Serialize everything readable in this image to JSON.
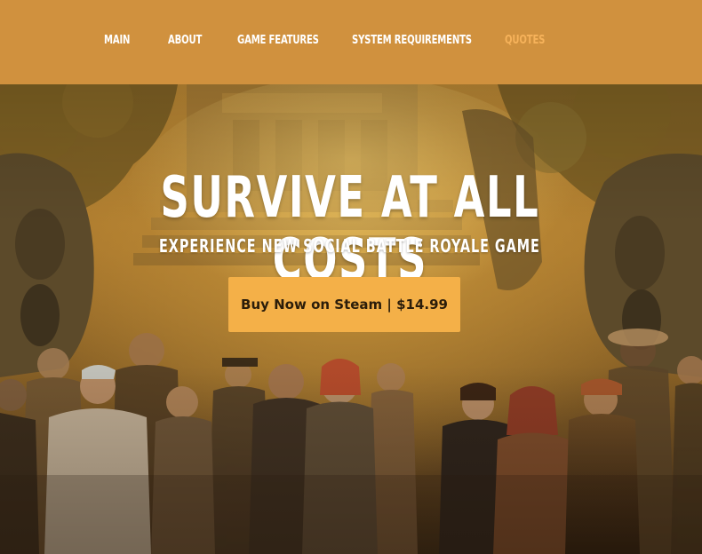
{
  "nav": {
    "items": [
      {
        "label": "MAIN"
      },
      {
        "label": "ABOUT"
      },
      {
        "label": "GAME FEATURES"
      },
      {
        "label": "SYSTEM REQUIREMENTS"
      },
      {
        "label": "QUOTES"
      }
    ]
  },
  "hero": {
    "title": "SURVIVE AT ALL COSTS",
    "subtitle": "EXPERIENCE NEW SOCIAL BATTLE ROYALE GAME",
    "cta_label": "Buy Now on Steam | $14.99",
    "background_image": "jungle-temple-survivors-artwork"
  },
  "colors": {
    "nav_background": "#d0913e",
    "nav_text": "#ffffff",
    "nav_active": "#f6b25a",
    "cta_background": "#f4b048",
    "cta_text": "#2b1d0a"
  }
}
